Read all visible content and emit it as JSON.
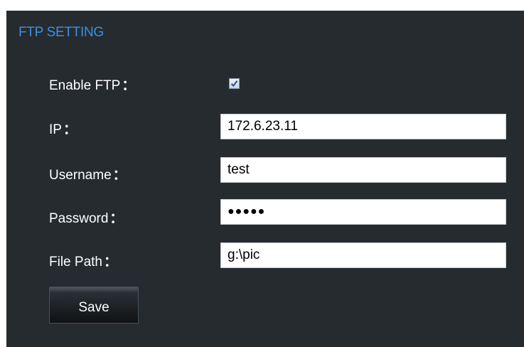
{
  "panel": {
    "title": "FTP SETTING"
  },
  "form": {
    "enable_ftp": {
      "label": "Enable FTP",
      "checked": true
    },
    "ip": {
      "label": "IP",
      "value": "172.6.23.11"
    },
    "username": {
      "label": "Username",
      "value": "test"
    },
    "password": {
      "label": "Password",
      "value": "●●●●●"
    },
    "file_path": {
      "label": "File Path",
      "value": "g:\\pic"
    },
    "colon": "："
  },
  "actions": {
    "save_label": "Save"
  },
  "colors": {
    "panel_background": "#262b30",
    "title_accent": "#3d8fe0"
  }
}
